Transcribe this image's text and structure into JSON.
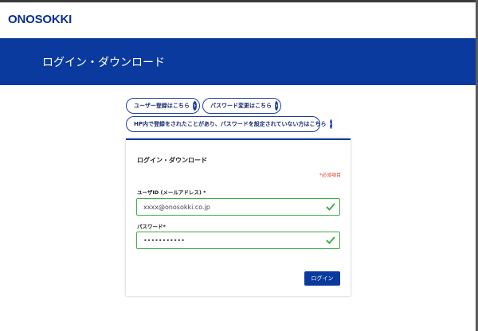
{
  "header": {
    "logo_text": "ONOSOKKI"
  },
  "banner": {
    "title": "ログイン・ダウンロード"
  },
  "links": {
    "register_label": "ユーザー登録はこちら",
    "change_password_label": "パスワード変更はこちら",
    "set_password_label": "HP内で登録をされたことがあり、パスワードを設定されていない方はこちら",
    "arrow_glyph": "›"
  },
  "form": {
    "title": "ログイン・ダウンロード",
    "required_note": "*必須項目",
    "userid_label": "ユーザID (メールアドレス) *",
    "userid_value": "xxxx@onosokki.co.jp",
    "password_label": "パスワード*",
    "password_value": "•••••••••••",
    "submit_label": "ログイン"
  },
  "colors": {
    "brand": "#0b3a9e",
    "valid": "#3fae47",
    "required": "#e0463a"
  }
}
